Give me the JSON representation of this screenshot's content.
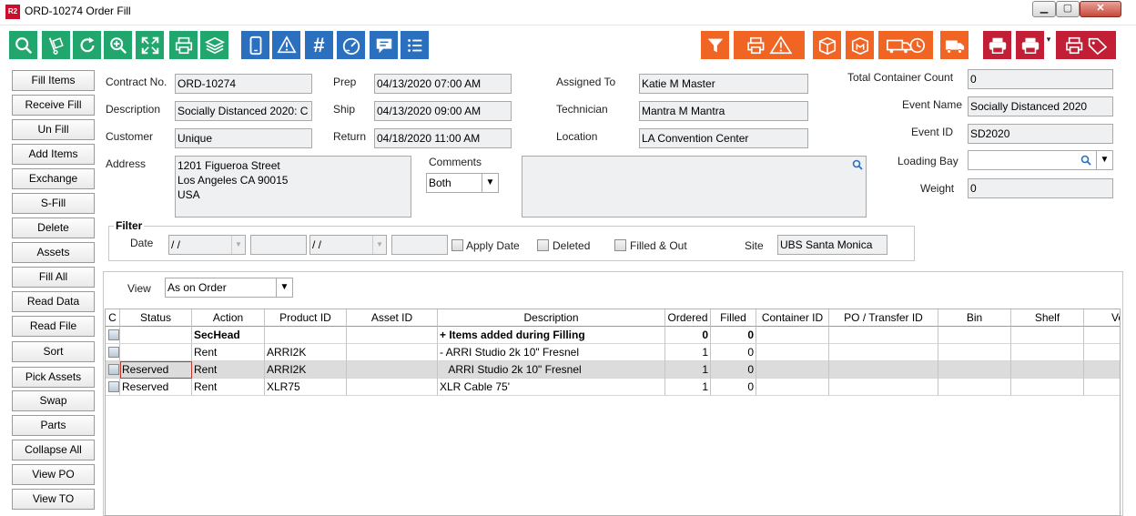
{
  "window": {
    "app_icon_text": "R2",
    "title": "ORD-10274 Order Fill",
    "min_glyph": "▁",
    "max_glyph": "▢",
    "close_glyph": "✕"
  },
  "toolbar": {
    "left_buttons": [
      {
        "icon": "search-icon",
        "color": "#21a66e"
      },
      {
        "icon": "hand-truck-icon",
        "color": "#21a66e"
      },
      {
        "icon": "refresh-icon",
        "color": "#21a66e"
      },
      {
        "icon": "zoom-in-icon",
        "color": "#21a66e"
      },
      {
        "icon": "expand-icon",
        "color": "#21a66e"
      },
      {
        "icon": "print-icon",
        "color": "#21a66e"
      },
      {
        "icon": "layers-icon",
        "color": "#21a66e"
      },
      {
        "icon": "tablet-icon",
        "color": "#2b6fbf"
      },
      {
        "icon": "warning-eye-icon",
        "color": "#2b6fbf"
      },
      {
        "icon": "hash-icon",
        "color": "#2b6fbf"
      },
      {
        "icon": "gauge-icon",
        "color": "#2b6fbf"
      },
      {
        "icon": "comment-icon",
        "color": "#2b6fbf"
      },
      {
        "icon": "list-icon",
        "color": "#2b6fbf"
      }
    ],
    "right_buttons": [
      {
        "icon": "filter-icon",
        "color": "#f06524"
      },
      {
        "icon": "print-warning-icon",
        "color": "#f06524"
      },
      {
        "icon": "box-icon",
        "color": "#f06524"
      },
      {
        "icon": "box-m-icon",
        "color": "#f06524"
      },
      {
        "icon": "truck-clock-icon",
        "color": "#f06524"
      },
      {
        "icon": "truck-icon",
        "color": "#f06524"
      },
      {
        "icon": "printer-red-icon",
        "color": "#c21f37"
      },
      {
        "icon": "printer-dropdown-icon",
        "color": "#c21f37"
      },
      {
        "icon": "print-tag-icon",
        "color": "#c21f37"
      }
    ],
    "dropdown_glyph": "▾"
  },
  "nav": {
    "buttons": [
      "Fill Items",
      "Receive Fill",
      "Un Fill",
      "Add Items",
      "Exchange",
      "S-Fill",
      "Delete",
      "Assets",
      "Fill  All",
      "Read Data",
      "Read File",
      "Sort",
      "Pick Assets",
      "Swap",
      "Parts",
      "Collapse All",
      "View PO",
      "View TO"
    ]
  },
  "form": {
    "contract_label": "Contract No.",
    "contract_value": "ORD-10274",
    "description_label": "Description",
    "description_value": "Socially Distanced 2020: C",
    "customer_label": "Customer",
    "customer_value": "Unique",
    "address_label": "Address",
    "address_lines": [
      "1201 Figueroa Street",
      "Los Angeles CA 90015",
      "USA"
    ],
    "prep_label": "Prep",
    "prep_value": "04/13/2020 07:00 AM",
    "ship_label": "Ship",
    "ship_value": "04/13/2020 09:00 AM",
    "return_label": "Return",
    "return_value": "04/18/2020 11:00 AM",
    "comments_label": "Comments",
    "comments_select": "Both",
    "assigned_label": "Assigned To",
    "assigned_value": "Katie M Master",
    "technician_label": "Technician",
    "technician_value": "Mantra M Mantra",
    "location_label": "Location",
    "location_value": "LA Convention Center",
    "total_container_label": "Total Container Count",
    "total_container_value": "0",
    "event_name_label": "Event Name",
    "event_name_value": "Socially Distanced 2020",
    "event_id_label": "Event ID",
    "event_id_value": "SD2020",
    "loading_bay_label": "Loading Bay",
    "loading_bay_value": "",
    "weight_label": "Weight",
    "weight_value": "0"
  },
  "filter": {
    "legend": "Filter",
    "date_label": "Date",
    "date_from": "/ /",
    "date_to": "/ /",
    "apply_date_label": "Apply Date",
    "deleted_label": "Deleted",
    "filled_out_label": "Filled & Out",
    "site_label": "Site",
    "site_value": "UBS Santa Monica"
  },
  "view": {
    "label": "View",
    "value": "As on Order"
  },
  "grid": {
    "columns": [
      "C",
      "Status",
      "Action",
      "Product ID",
      "Asset ID",
      "Description",
      "Ordered",
      "Filled",
      "Container ID",
      "PO / Transfer ID",
      "Bin",
      "Shelf",
      "Ve"
    ],
    "rows": [
      {
        "status": "",
        "action": "SecHead",
        "product_id": "",
        "asset_id": "",
        "description": "+ Items added during Filling",
        "ordered": "0",
        "filled": "0",
        "bold": true
      },
      {
        "status": "",
        "action": "Rent",
        "product_id": "ARRI2K",
        "asset_id": "",
        "description": "- ARRI Studio 2k 10\" Fresnel",
        "ordered": "1",
        "filled": "0"
      },
      {
        "status": "Reserved",
        "action": "Rent",
        "product_id": "ARRI2K",
        "asset_id": "",
        "description": "   ARRI Studio 2k 10\" Fresnel",
        "ordered": "1",
        "filled": "0",
        "selected": true
      },
      {
        "status": "Reserved",
        "action": "Rent",
        "product_id": "XLR75",
        "asset_id": "",
        "description": "XLR Cable 75'",
        "ordered": "1",
        "filled": "0"
      }
    ]
  }
}
